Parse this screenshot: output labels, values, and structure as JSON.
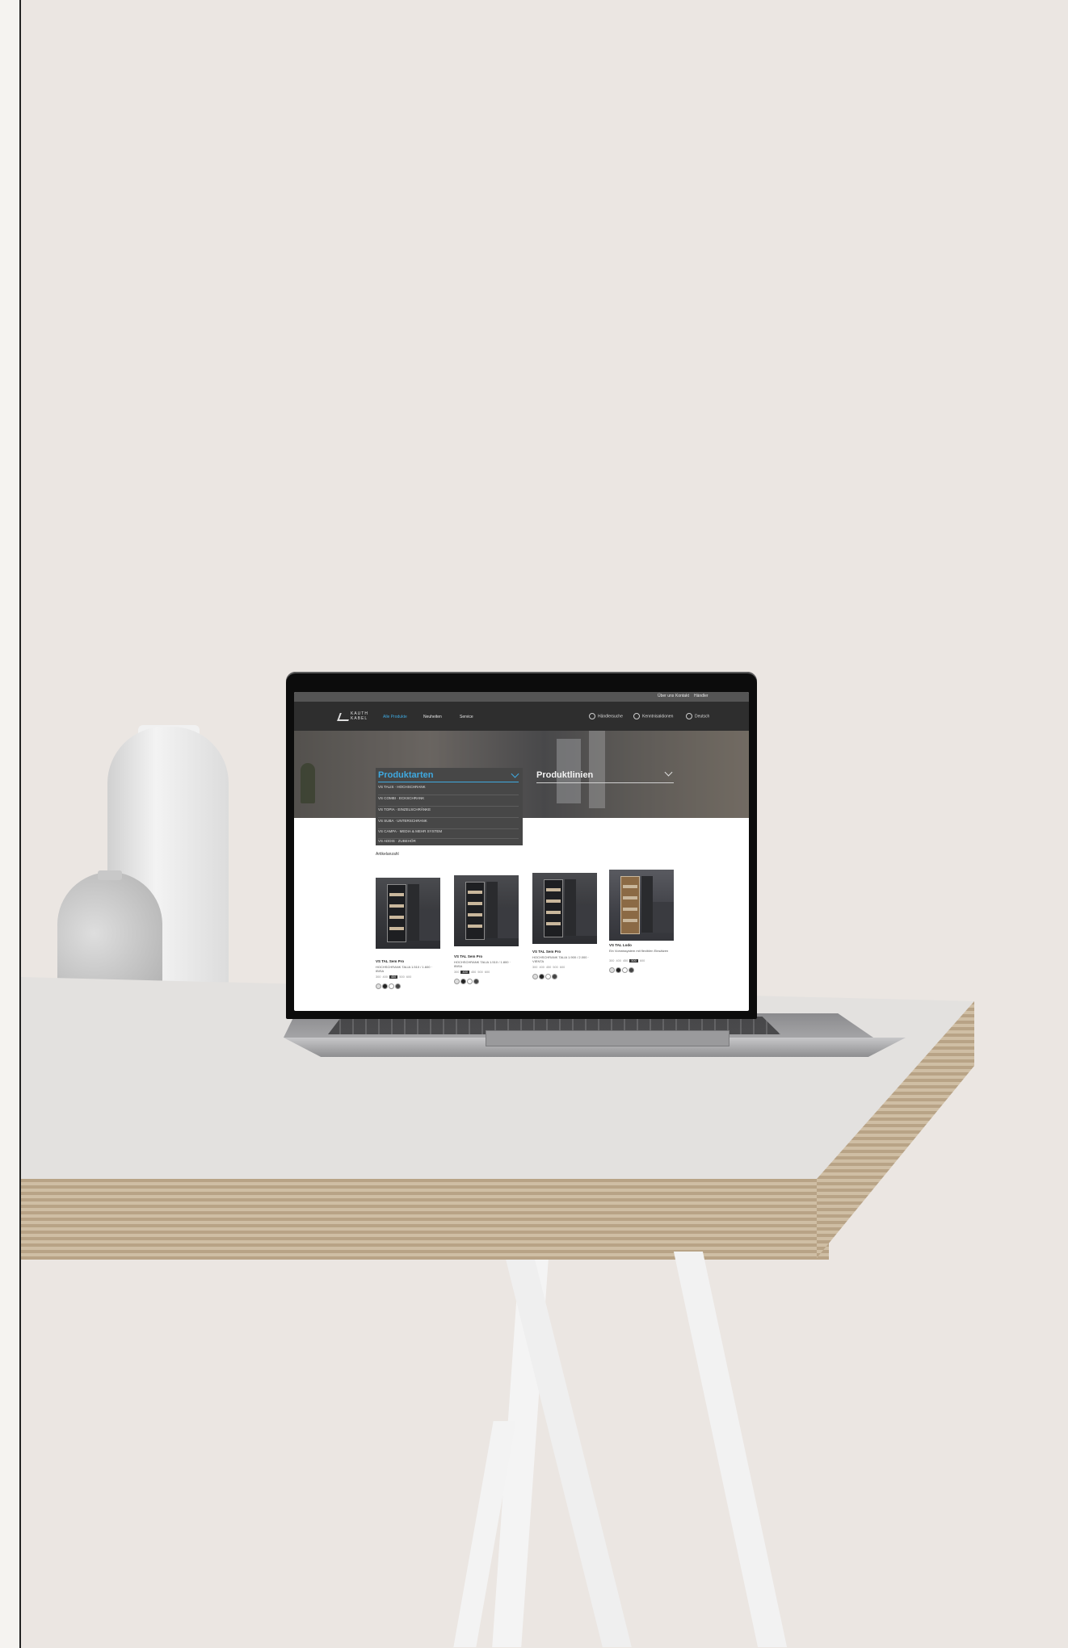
{
  "site": {
    "utility_links": [
      "Über uns",
      "Kontakt",
      "Händler"
    ],
    "logo": {
      "line1": "KAUTH",
      "line2": "KABEL"
    },
    "nav": {
      "items": [
        "Alle Produkte",
        "Neuheiten",
        "Service"
      ],
      "active_index": 0,
      "right": [
        "Händlersuche",
        "Kenntnisaktionen",
        "Deutsch"
      ]
    },
    "hero": {
      "dropdown": {
        "title": "Produktarten",
        "items": [
          "VS TALIS · HOCHSCHRANK",
          "VS COMBI · ECKSCHRANK",
          "VS TOPIA · EINZELSCHRÄNKE",
          "VS SUBA · UNTERSCHRANK",
          "VS CAMPA · MEDIA & MEHR SYSTEM",
          "VS ADDIS · ZUBEHÖR"
        ]
      },
      "second_dropdown": {
        "title": "Produktlinien"
      }
    },
    "count_label": "Artikelanzahl",
    "products": [
      {
        "name": "VS TAL Sem Pro",
        "desc": "HOCHSCHRANK TALIA 1.510 / 1.600 · IBISA",
        "sizes": [
          "300",
          "400",
          "450",
          "500",
          "600"
        ],
        "active_size": 2
      },
      {
        "name": "VS TAL Sem Pro",
        "desc": "HOCHSCHRANK TALIA 1.510 / 1.800 · IBISA",
        "sizes": [
          "300",
          "400",
          "450",
          "500",
          "600"
        ],
        "active_size": 1
      },
      {
        "name": "VS TAL Sem Pro",
        "desc": "HOCHSCHRANK TALIA 1.900 / 2.000 · VIENTA",
        "sizes": [
          "300",
          "400",
          "450",
          "500",
          "600"
        ],
        "active_size": -1
      },
      {
        "name": "VS TAL Lodo",
        "desc": "Ein Vorratssystem mit flexiblen Einsätzen",
        "sizes": [
          "300",
          "400",
          "450",
          "500",
          "600"
        ],
        "active_size": 3
      }
    ]
  }
}
